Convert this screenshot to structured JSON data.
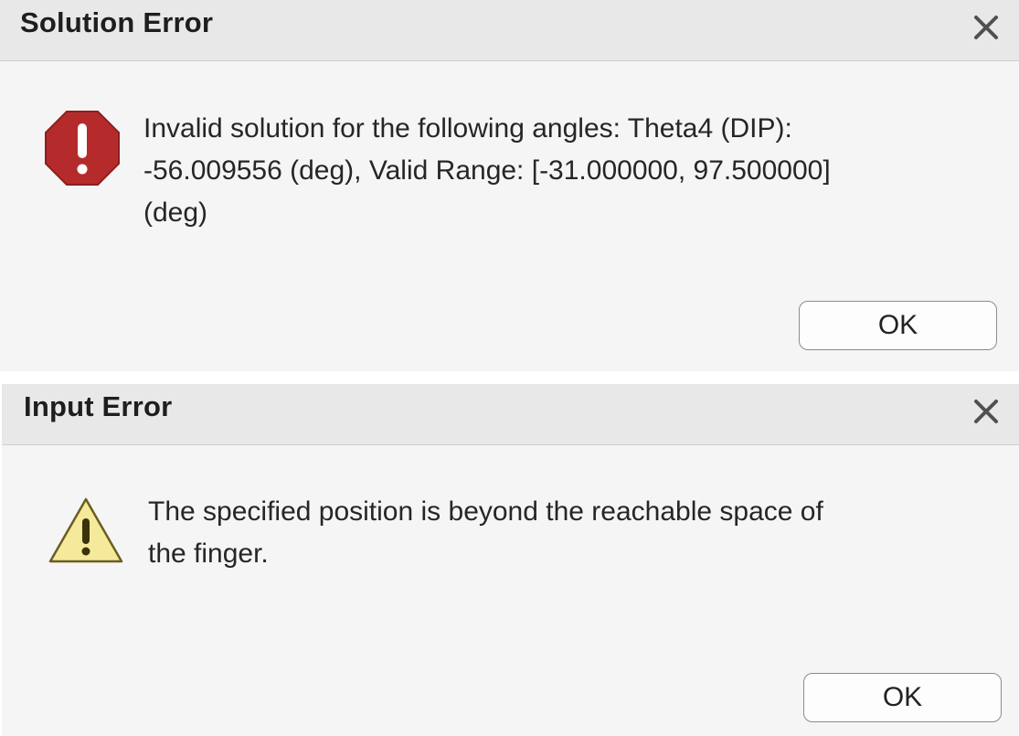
{
  "dialogs": [
    {
      "title": "Solution Error",
      "icon": "error-stop-icon",
      "icon_color": "#b52b2b",
      "message": "Invalid solution for the following angles: Theta4 (DIP):\n-56.009556 (deg), Valid Range: [-31.000000, 97.500000]\n(deg)",
      "button_label": "OK"
    },
    {
      "title": "Input Error",
      "icon": "warning-triangle-icon",
      "icon_color": "#f5e99b",
      "message": "The specified position is beyond the reachable space of\nthe finger.",
      "button_label": "OK"
    }
  ],
  "colors": {
    "titlebar_bg": "#e8e8e8",
    "dialog_bg": "#f5f5f5",
    "error_red": "#b52b2b",
    "warning_yellow": "#f5e99b"
  }
}
